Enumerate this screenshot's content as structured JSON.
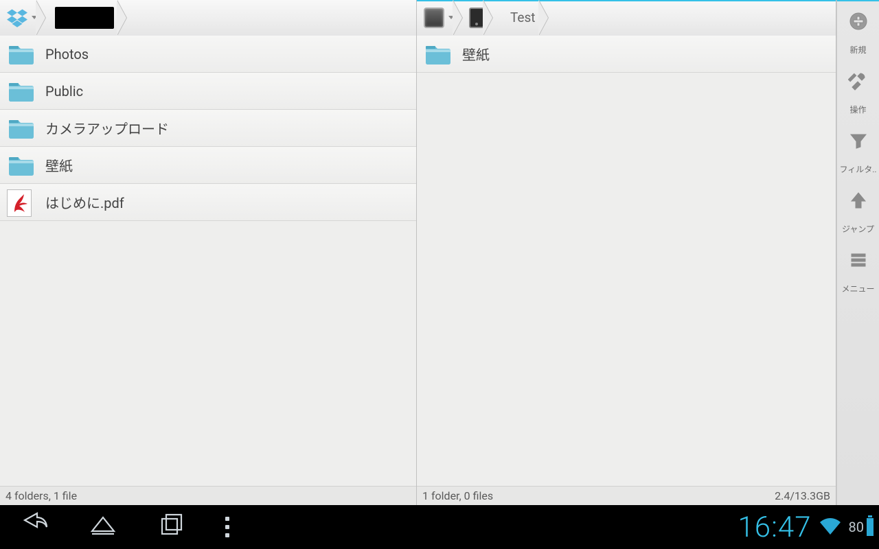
{
  "leftPane": {
    "crumbs": [
      {
        "kind": "dropbox"
      },
      {
        "kind": "black"
      }
    ],
    "items": [
      {
        "type": "folder",
        "name": "Photos"
      },
      {
        "type": "folder",
        "name": "Public"
      },
      {
        "type": "folder",
        "name": "カメラアップロード"
      },
      {
        "type": "folder",
        "name": "壁紙"
      },
      {
        "type": "pdf",
        "name": "はじめに.pdf"
      }
    ],
    "status": "4 folders, 1 file"
  },
  "rightPane": {
    "crumbs": [
      {
        "kind": "drive"
      },
      {
        "kind": "tablet"
      },
      {
        "kind": "text",
        "label": "Test"
      }
    ],
    "items": [
      {
        "type": "folder",
        "name": "壁紙"
      }
    ],
    "statusLeft": "1 folder, 0 files",
    "statusRight": "2.4/13.3GB"
  },
  "sidebar": [
    {
      "id": "new",
      "label": "新規"
    },
    {
      "id": "ops",
      "label": "操作"
    },
    {
      "id": "filter",
      "label": "フィルタ.."
    },
    {
      "id": "jump",
      "label": "ジャンプ"
    },
    {
      "id": "menu",
      "label": "メニュー"
    }
  ],
  "statusbar": {
    "time": "16:47",
    "battery": "80"
  }
}
